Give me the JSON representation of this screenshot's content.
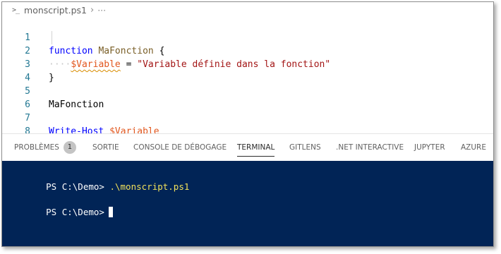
{
  "breadcrumb": {
    "icon": ">_",
    "file": "monscript.ps1",
    "separator": "›",
    "trail": "···"
  },
  "editor": {
    "line_numbers": [
      "1",
      "2",
      "3",
      "4",
      "5",
      "6",
      "7",
      "8"
    ],
    "line1": {
      "keyword": "function",
      "name": "MaFonction",
      "brace": "{"
    },
    "line2": {
      "indent": "····",
      "variable": "$Variable",
      "equals": " = ",
      "string": "\"Variable définie dans la fonction\""
    },
    "line3": {
      "brace": "}"
    },
    "line5": {
      "call": "MaFonction"
    },
    "line7": {
      "cmdlet": "Write-Host",
      "variable": "$Variable"
    }
  },
  "panel": {
    "tabs": [
      {
        "label": "PROBLÈMES",
        "badge": "1"
      },
      {
        "label": "SORTIE"
      },
      {
        "label": "CONSOLE DE DÉBOGAGE"
      },
      {
        "label": "TERMINAL",
        "active": true
      },
      {
        "label": "GITLENS"
      },
      {
        "label": ".NET INTERACTIVE"
      },
      {
        "label": "JUPYTER"
      },
      {
        "label": "AZURE"
      }
    ]
  },
  "terminal": {
    "prompt1": "PS C:\\Demo>",
    "command1": ".\\monscript.ps1",
    "prompt2": "PS C:\\Demo>"
  },
  "colors": {
    "terminal_bg": "#012456",
    "keyword": "#0000ff",
    "variable": "#e2571e",
    "string": "#a31515",
    "line_number": "#237893"
  }
}
